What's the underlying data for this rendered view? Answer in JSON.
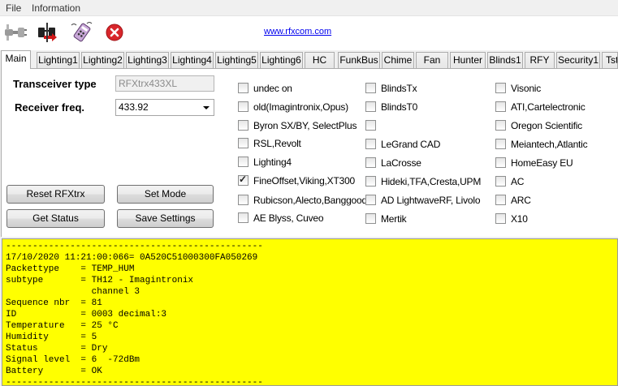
{
  "menu": {
    "file": "File",
    "information": "Information"
  },
  "toolbar": {
    "link": "www.rfxcom.com",
    "icons": [
      "connect-plug-icon",
      "disconnect-icon",
      "rfx-device-icon",
      "close-icon"
    ]
  },
  "tabs": [
    "Main",
    "Lighting1",
    "Lighting2",
    "Lighting3",
    "Lighting4",
    "Lighting5",
    "Lighting6",
    "HC",
    "FunkBus",
    "Chime",
    "Fan",
    "Hunter",
    "Blinds1",
    "RFY",
    "Security1",
    "Tst"
  ],
  "main": {
    "transceiver_type_label": "Transceiver type",
    "transceiver_type_value": "RFXtrx433XL",
    "receiver_freq_label": "Receiver freq.",
    "receiver_freq_value": "433.92",
    "buttons": {
      "reset": "Reset RFXtrx",
      "set_mode": "Set Mode",
      "get_status": "Get Status",
      "save_settings": "Save Settings"
    },
    "protocols": {
      "col1": [
        {
          "label": "undec on",
          "checked": false
        },
        {
          "label": "old(Imagintronix,Opus)",
          "checked": false
        },
        {
          "label": "Byron SX/BY, SelectPlus",
          "checked": false
        },
        {
          "label": "RSL,Revolt",
          "checked": false
        },
        {
          "label": "Lighting4",
          "checked": false
        },
        {
          "label": "FineOffset,Viking,XT300",
          "checked": true
        },
        {
          "label": "Rubicson,Alecto,Banggood",
          "checked": false
        },
        {
          "label": "AE Blyss, Cuveo",
          "checked": false
        }
      ],
      "col2": [
        {
          "label": "BlindsTx",
          "checked": false
        },
        {
          "label": "BlindsT0",
          "checked": false
        },
        {
          "label": "",
          "checked": false
        },
        {
          "label": "LeGrand CAD",
          "checked": false
        },
        {
          "label": "LaCrosse",
          "checked": false
        },
        {
          "label": "Hideki,TFA,Cresta,UPM",
          "checked": false
        },
        {
          "label": "AD LightwaveRF, Livolo",
          "checked": false
        },
        {
          "label": "Mertik",
          "checked": false
        }
      ],
      "col3": [
        {
          "label": "Visonic",
          "checked": false
        },
        {
          "label": "ATI,Cartelectronic",
          "checked": false
        },
        {
          "label": "Oregon Scientific",
          "checked": false
        },
        {
          "label": "Meiantech,Atlantic",
          "checked": false
        },
        {
          "label": "HomeEasy EU",
          "checked": false
        },
        {
          "label": "AC",
          "checked": false
        },
        {
          "label": "ARC",
          "checked": false
        },
        {
          "label": "X10",
          "checked": false
        }
      ]
    }
  },
  "console": {
    "lines": [
      "------------------------------------------------",
      "17/10/2020 11:21:00:066= 0A520C51000300FA050269",
      "Packettype    = TEMP_HUM",
      "subtype       = TH12 - Imagintronix",
      "                channel 3",
      "Sequence nbr  = 81",
      "ID            = 0003 decimal:3",
      "Temperature   = 25 °C",
      "Humidity      = 5",
      "Status        = Dry",
      "Signal level  = 6  -72dBm",
      "Battery       = OK",
      "------------------------------------------------"
    ]
  }
}
